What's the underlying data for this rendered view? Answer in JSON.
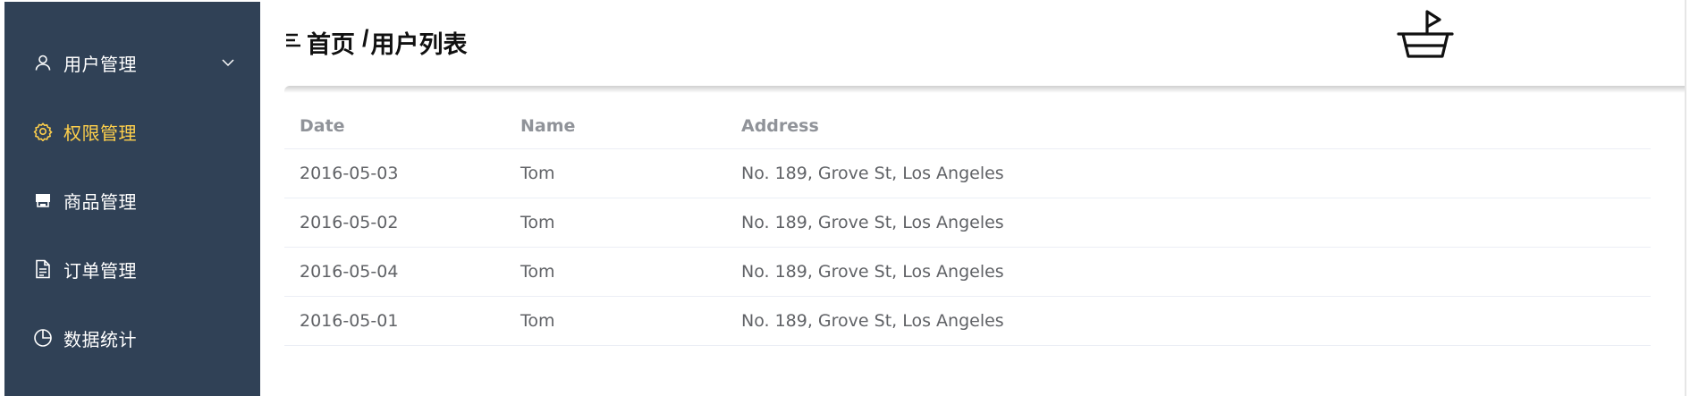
{
  "sidebar": {
    "bg_color": "#304156",
    "active_color": "#ffd04b",
    "items": [
      {
        "label": "用户管理",
        "icon": "user-icon",
        "has_chevron": true
      },
      {
        "label": "权限管理",
        "icon": "gear-icon",
        "active": true
      },
      {
        "label": "商品管理",
        "icon": "shop-icon"
      },
      {
        "label": "订单管理",
        "icon": "document-icon"
      },
      {
        "label": "数据统计",
        "icon": "pie-chart-icon"
      }
    ]
  },
  "header": {
    "menu_icon": "menu-toggle-icon",
    "breadcrumb": [
      "首页",
      "用户列表"
    ],
    "breadcrumb_separator": "/",
    "logo_icon": "boat-icon"
  },
  "table": {
    "columns": [
      "Date",
      "Name",
      "Address"
    ],
    "rows": [
      [
        "2016-05-03",
        "Tom",
        "No. 189, Grove St, Los Angeles"
      ],
      [
        "2016-05-02",
        "Tom",
        "No. 189, Grove St, Los Angeles"
      ],
      [
        "2016-05-04",
        "Tom",
        "No. 189, Grove St, Los Angeles"
      ],
      [
        "2016-05-01",
        "Tom",
        "No. 189, Grove St, Los Angeles"
      ]
    ]
  }
}
